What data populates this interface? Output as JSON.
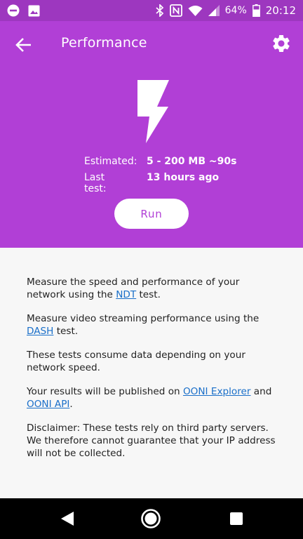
{
  "status_bar": {
    "battery": "64%",
    "time": "20:12",
    "icons": [
      "do-not-disturb-icon",
      "image-icon",
      "bluetooth-icon",
      "nfc-icon",
      "wifi-icon",
      "cell-signal-icon",
      "battery-icon"
    ]
  },
  "header": {
    "title": "Performance",
    "back_icon": "arrow-back-icon",
    "settings_icon": "gear-icon"
  },
  "hero": {
    "icon": "lightning-bolt-icon",
    "estimated_label": "Estimated:",
    "estimated_value": "5 - 200 MB ~90s",
    "last_test_label": "Last test:",
    "last_test_value": "13 hours ago",
    "run_label": "Run"
  },
  "description": {
    "p1_before": "Measure the speed and performance of your network using the ",
    "p1_link": "NDT",
    "p1_after": " test.",
    "p2_before": "Measure video streaming performance using the ",
    "p2_link": "DASH",
    "p2_after": " test.",
    "p3": "These tests consume data depending on your network speed.",
    "p4_before": "Your results will be published on ",
    "p4_link1": "OONI Explorer",
    "p4_middle": " and ",
    "p4_link2": "OONI API",
    "p4_after": ".",
    "p5": "Disclaimer: These tests rely on third party servers. We therefore cannot guarantee that your IP address will not be collected."
  },
  "colors": {
    "accent": "#b13fd6",
    "status_bar": "#9d37bf",
    "link": "#1a6fc9",
    "background": "#f7f7f7"
  },
  "nav_bar": {
    "icons": [
      "back-triangle-icon",
      "home-circle-icon",
      "recents-square-icon"
    ]
  }
}
